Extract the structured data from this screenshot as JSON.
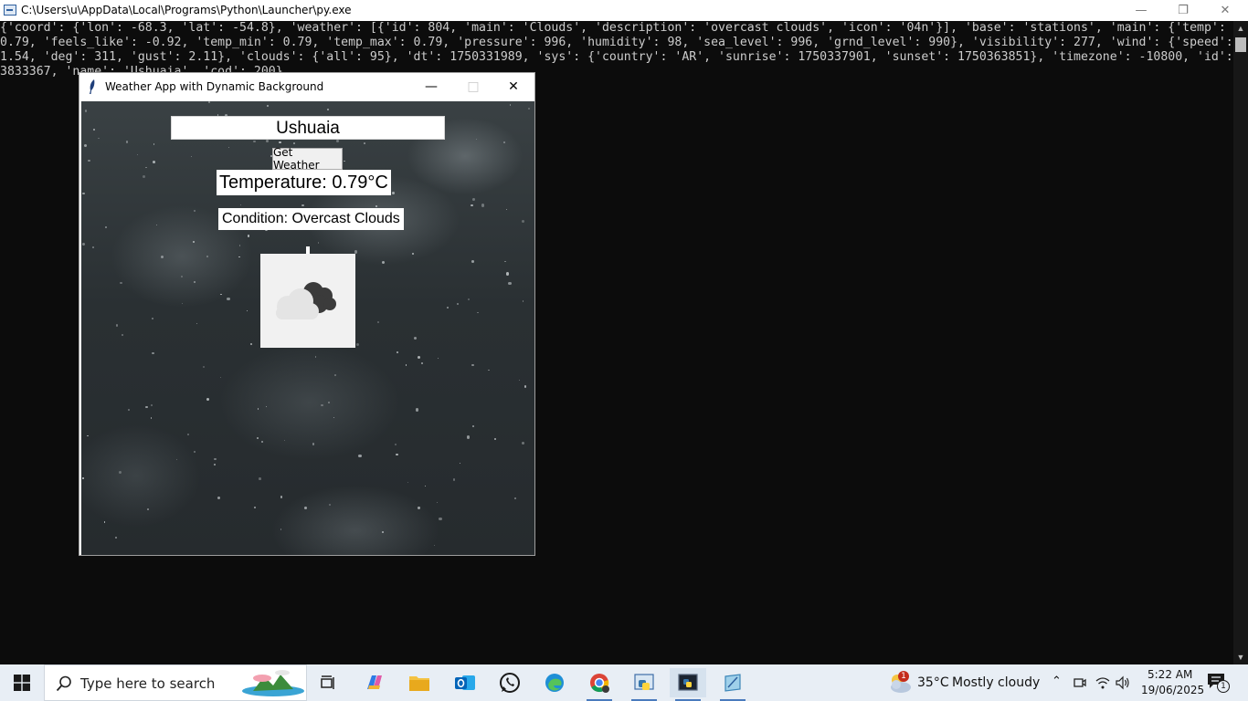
{
  "console": {
    "title": "C:\\Users\\u\\AppData\\Local\\Programs\\Python\\Launcher\\py.exe",
    "output": "{'coord': {'lon': -68.3, 'lat': -54.8}, 'weather': [{'id': 804, 'main': 'Clouds', 'description': 'overcast clouds', 'icon': '04n'}], 'base': 'stations', 'main': {'temp': 0.79, 'feels_like': -0.92, 'temp_min': 0.79, 'temp_max': 0.79, 'pressure': 996, 'humidity': 98, 'sea_level': 996, 'grnd_level': 990}, 'visibility': 277, 'wind': {'speed': 1.54, 'deg': 311, 'gust': 2.11}, 'clouds': {'all': 95}, 'dt': 1750331989, 'sys': {'country': 'AR', 'sunrise': 1750337901, 'sunset': 1750363851}, 'timezone': -10800, 'id': 3833367, 'name': 'Ushuaia', 'cod': 200}"
  },
  "app": {
    "title": "Weather App with Dynamic Background",
    "city_value": "Ushuaia",
    "button_label": "Get Weather",
    "temperature": "Temperature: 0.79°C",
    "condition": "Condition: Overcast Clouds",
    "weather_icon": "clouds-night-icon"
  },
  "taskbar": {
    "search_placeholder": "Type here to search",
    "weather_temp": "35°C",
    "weather_text": "Mostly cloudy",
    "weather_badge": "1",
    "time": "5:22 AM",
    "date": "19/06/2025",
    "notification_count": "1",
    "accent": "#0078d4"
  }
}
